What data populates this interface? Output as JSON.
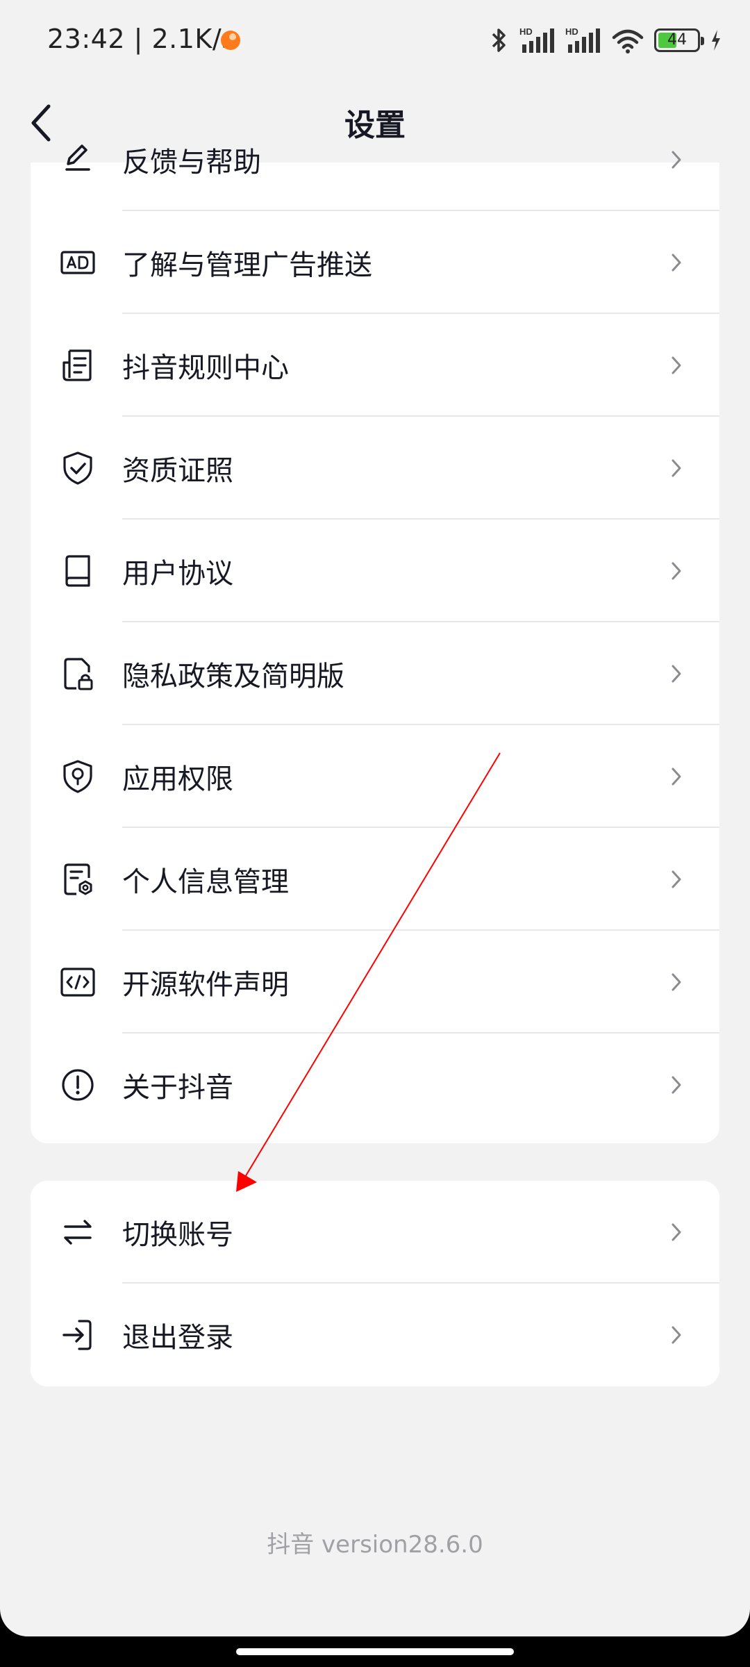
{
  "status_bar": {
    "time": "23:42 | 2.1K/s",
    "hd1": "HD",
    "hd2": "HD",
    "battery": "44",
    "icons": [
      "bluetooth-icon",
      "signal-icon",
      "wifi-icon",
      "battery-icon",
      "charging-icon"
    ]
  },
  "nav": {
    "back_icon": "chevron-left-icon",
    "title": "设置"
  },
  "settings_list": [
    {
      "label": "反馈与帮助",
      "icon": "feedback-icon"
    },
    {
      "label": "了解与管理广告推送",
      "icon": "ad-icon"
    },
    {
      "label": "抖音规则中心",
      "icon": "rules-document-icon"
    },
    {
      "label": "资质证照",
      "icon": "shield-check-icon"
    },
    {
      "label": "用户协议",
      "icon": "book-icon"
    },
    {
      "label": "隐私政策及简明版",
      "icon": "file-lock-icon"
    },
    {
      "label": "应用权限",
      "icon": "shield-location-icon"
    },
    {
      "label": "个人信息管理",
      "icon": "file-gear-icon"
    },
    {
      "label": "开源软件声明",
      "icon": "code-icon"
    },
    {
      "label": "关于抖音",
      "icon": "info-circle-icon"
    }
  ],
  "account_list": [
    {
      "label": "切换账号",
      "icon": "switch-arrows-icon"
    },
    {
      "label": "退出登录",
      "icon": "logout-icon"
    }
  ],
  "footer": {
    "version": "抖音 version28.6.0"
  },
  "colors": {
    "background": "#f2f2f2",
    "card": "#ffffff",
    "text": "#161823",
    "secondary_text": "#a0a0a5",
    "annotation_arrow": "#ff0000",
    "battery_fill": "#4fc740"
  }
}
